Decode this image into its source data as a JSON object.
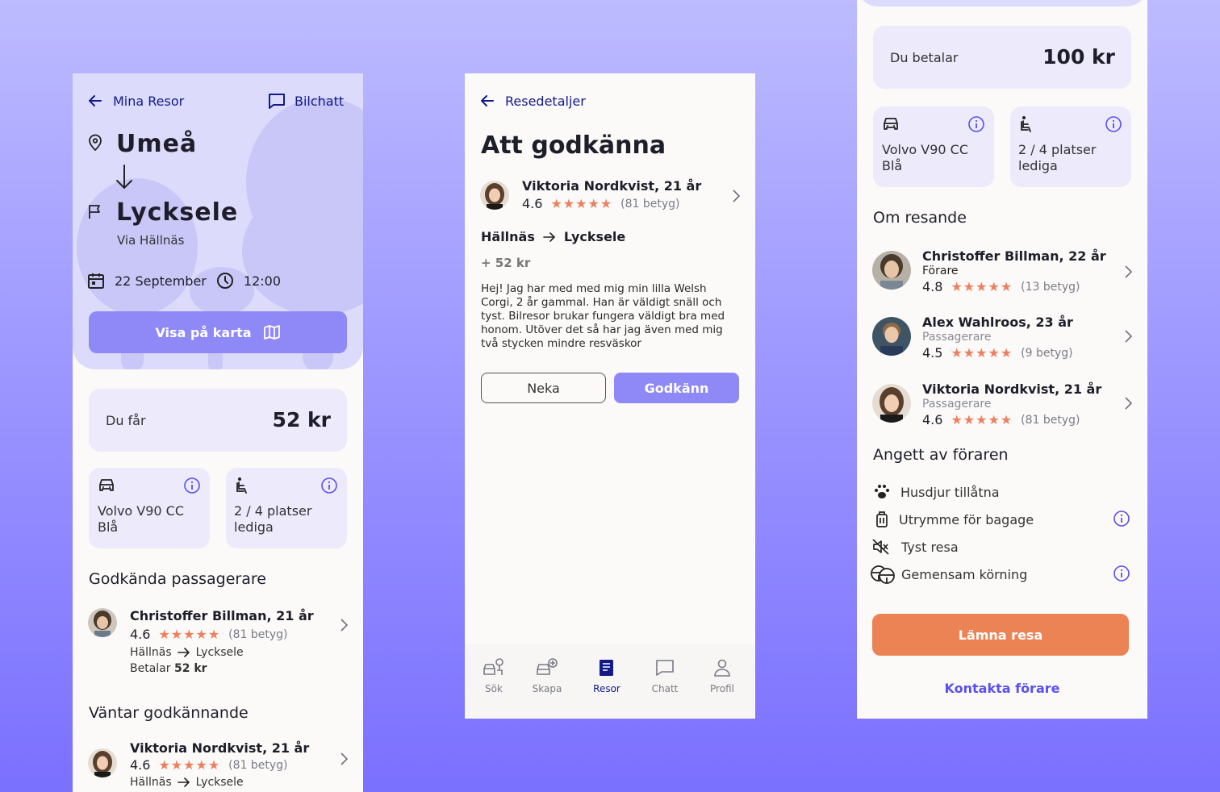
{
  "left": {
    "back_label": "Mina Resor",
    "chat_label": "Bilchatt",
    "from": "Umeå",
    "to": "Lycksele",
    "via": "Via Hällnäs",
    "date": "22 September",
    "time": "12:00",
    "map_button": "Visa på karta",
    "earn_label": "Du får",
    "earn_value": "52 kr",
    "car_name": "Volvo V90 CC",
    "car_color": "Blå",
    "seats_line1": "2 / 4 platser",
    "seats_line2": "lediga",
    "approved_title": "Godkända passagerare",
    "approved": [
      {
        "name": "Christoffer Billman, 21 år",
        "rating": "4.6",
        "stars": "★★★★★",
        "count": "(81 betyg)",
        "from": "Hällnäs",
        "to": "Lycksele",
        "pays_label": "Betalar",
        "pays_value": "52 kr"
      }
    ],
    "pending_title": "Väntar godkännande",
    "pending": [
      {
        "name": "Viktoria Nordkvist, 21 år",
        "rating": "4.6",
        "stars": "★★★★★",
        "count": "(81 betyg)",
        "from": "Hällnäs",
        "to": "Lycksele"
      }
    ]
  },
  "middle": {
    "back_label": "Resedetaljer",
    "title": "Att godkänna",
    "person": {
      "name": "Viktoria Nordkvist, 21 år",
      "rating": "4.6",
      "stars": "★★★★★",
      "count": "(81 betyg)"
    },
    "from": "Hällnäs",
    "to": "Lycksele",
    "price": "+ 52 kr",
    "message": "Hej! Jag har med med mig min lilla Welsh Corgi, 2 år gammal. Han är väldigt snäll och tyst. Bilresor brukar fungera väldigt bra med honom. Utöver det så har jag även med mig två stycken mindre resväskor",
    "deny_button": "Neka",
    "approve_button": "Godkänn",
    "nav": [
      {
        "label": "Sök",
        "icon": "search-car-icon",
        "active": false
      },
      {
        "label": "Skapa",
        "icon": "add-car-icon",
        "active": false
      },
      {
        "label": "Resor",
        "icon": "trips-icon",
        "active": true
      },
      {
        "label": "Chatt",
        "icon": "chat-icon",
        "active": false
      },
      {
        "label": "Profil",
        "icon": "profile-icon",
        "active": false
      }
    ]
  },
  "right": {
    "pay_label": "Du betalar",
    "pay_value": "100 kr",
    "car_name": "Volvo V90 CC",
    "car_color": "Blå",
    "seats_line1": "2 / 4 platser",
    "seats_line2": "lediga",
    "travellers_title": "Om resande",
    "travellers": [
      {
        "name": "Christoffer Billman, 22 år",
        "role": "Förare",
        "rating": "4.8",
        "stars": "★★★★★",
        "count": "(13 betyg)"
      },
      {
        "name": "Alex Wahlroos, 23 år",
        "role": "Passagerare",
        "rating": "4.5",
        "stars": "★★★★★",
        "count": "(9 betyg)"
      },
      {
        "name": "Viktoria Nordkvist, 21 år",
        "role": "Passagerare",
        "rating": "4.6",
        "stars": "★★★★★",
        "count": "(81 betyg)"
      }
    ],
    "driver_title": "Angett av föraren",
    "features": [
      {
        "label": "Husdjur tillåtna",
        "icon": "paw-icon",
        "info": false
      },
      {
        "label": "Utrymme för bagage",
        "icon": "luggage-icon",
        "info": true
      },
      {
        "label": "Tyst resa",
        "icon": "mute-icon",
        "info": false
      },
      {
        "label": "Gemensam körning",
        "icon": "steering-wheel-icon",
        "info": true
      }
    ],
    "leave_button": "Lämna resa",
    "contact_link": "Kontakta förare"
  },
  "colors": {
    "accent": "#8f88f7",
    "navy": "#121a8a",
    "card": "#eceafb",
    "star": "#ec7f5e",
    "leave": "#ec8354"
  }
}
